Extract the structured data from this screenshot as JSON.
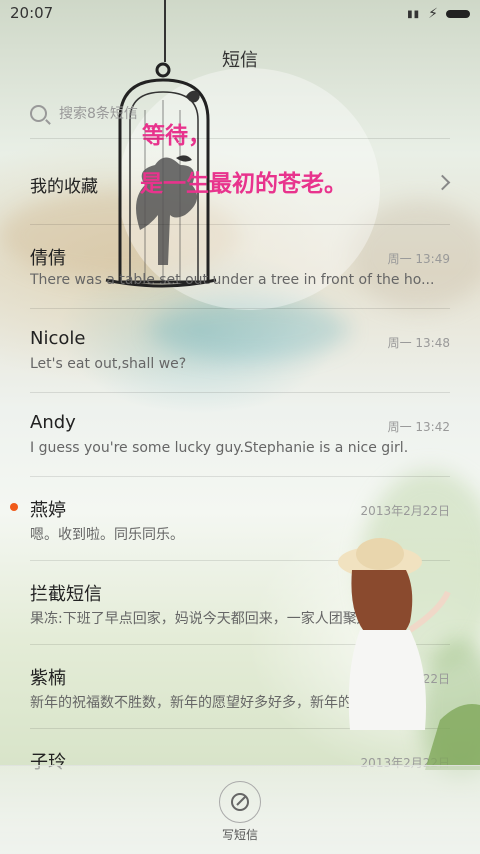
{
  "status_bar": {
    "time": "20:07"
  },
  "header": {
    "title": "短信"
  },
  "search": {
    "placeholder": "搜索8条短信"
  },
  "favorites": {
    "label": "我的收藏"
  },
  "quote": {
    "line1": "等待，",
    "line2": "是一生最初的苍老。"
  },
  "conversations": [
    {
      "name": "倩倩",
      "time": "周一 13:49",
      "snippet": "There was a table set out under a tree in front of the ho...",
      "unread": false
    },
    {
      "name": "Nicole",
      "time": "周一 13:48",
      "snippet": "Let's eat out,shall we?",
      "unread": false
    },
    {
      "name": "Andy",
      "time": "周一 13:42",
      "snippet": "I guess you're some lucky guy.Stephanie is a nice girl.",
      "unread": false
    },
    {
      "name": "燕婷",
      "time": "2013年2月22日",
      "snippet": "嗯。收到啦。同乐同乐。",
      "unread": true
    },
    {
      "name": "拦截短信",
      "time": "",
      "snippet": "果冻:下班了早点回家，妈说今天都回来，一家人团聚边...",
      "unread": false
    },
    {
      "name": "紫楠",
      "time": "2013年2月22日",
      "snippet": "新年的祝福数不胜数，新年的愿望好多好多，新年的问候...",
      "unread": false
    },
    {
      "name": "子玲",
      "time": "2013年2月22日",
      "snippet": "",
      "unread": false
    }
  ],
  "compose": {
    "label": "写短信",
    "icon": "compose-icon"
  },
  "colors": {
    "unread_dot": "#f05a1a",
    "quote_text": "#e8338d"
  }
}
